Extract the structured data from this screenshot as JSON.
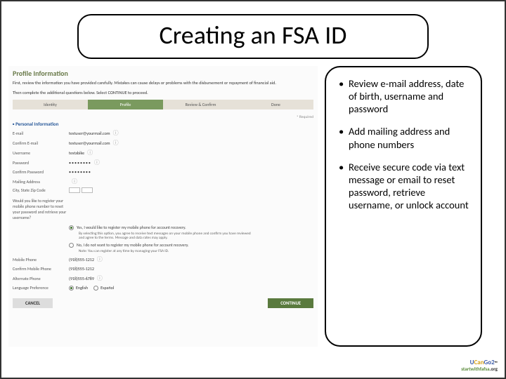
{
  "slide": {
    "title": "Creating an FSA ID"
  },
  "bullets": [
    "Review e-mail address, date of birth, username and password",
    "Add mailing address and phone numbers",
    "Receive secure code via text message or email to reset password, retrieve username, or unlock account"
  ],
  "screenshot": {
    "header": "Profile Information",
    "instr1": "First, review the information you have provided carefully. Mistakes can cause delays or problems with the disbursement or repayment of financial aid.",
    "instr2": "Then complete the additional questions below. Select CONTINUE to proceed.",
    "steps": [
      "Identity",
      "Profile",
      "Review & Confirm",
      "Done"
    ],
    "active_step": 1,
    "required_label": "* Required",
    "section_personal": "Personal Information",
    "fields": {
      "email_label": "E-mail",
      "email_val": "testuser@yourmail.com",
      "confirm_email_label": "Confirm E-mail",
      "confirm_email_val": "testuser@yourmail.com",
      "username_label": "Username",
      "username_val": "testabike",
      "password_label": "Password",
      "password_val": "••••••••",
      "confirm_pw_label": "Confirm Password",
      "confirm_pw_val": "••••••••",
      "mailing_label": "Mailing Address",
      "mailing_val": "",
      "csz_label": "City, State Zip Code",
      "phone_q_label": "Would you like to register your mobile phone number to reset your password and retrieve your username?",
      "opt_yes": "Yes, I would like to register my mobile phone for account recovery.",
      "opt_yes_sub": "By selecting this option, you agree to receive text messages on your mobile phone and confirm you have reviewed and agree to the terms. Message and data rates may apply.",
      "opt_no": "No, I do not want to register my mobile phone for account recovery.",
      "opt_no_sub": "Note: You can register at any time by managing your FSA ID.",
      "mobile_label": "Mobile Phone",
      "mobile_val": "(918)555-1212",
      "confirm_mobile_label": "Confirm Mobile Phone",
      "confirm_mobile_val": "(918)555-1212",
      "alt_label": "Alternate Phone",
      "alt_val": "(918)555-6789",
      "lang_label": "Language Preference",
      "lang_en": "English",
      "lang_es": "Español"
    },
    "buttons": {
      "cancel": "CANCEL",
      "cont": "CONTINUE"
    }
  },
  "logos": {
    "ucango2": "UCanGo2",
    "startwith": "startwithfafsa",
    "org": ".org"
  }
}
